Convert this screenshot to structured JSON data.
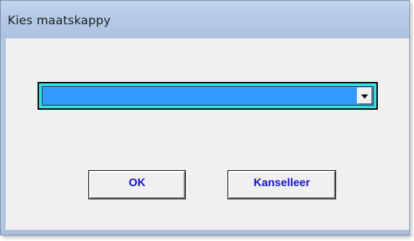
{
  "window": {
    "title": "Kies maatskappy"
  },
  "company_select": {
    "selected_value": "",
    "icon": "chevron-down-icon"
  },
  "buttons": {
    "ok_label": "OK",
    "cancel_label": "Kanselleer"
  },
  "colors": {
    "titlebar": "#b5cbe6",
    "dialog_background": "#f0f0f0",
    "combo_selection": "#3399ff",
    "combo_focus_ring": "#33e0e0",
    "button_text": "#1a14c8"
  }
}
